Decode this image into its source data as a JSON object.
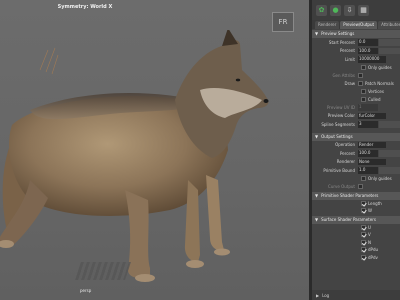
{
  "viewport": {
    "title": "Symmetry: World X",
    "bottom_label": "persp",
    "view_cube_label": "FR"
  },
  "toolbar": {
    "icons": [
      "fur-icon",
      "turtle-icon",
      "down-arrow-icon",
      "grid-icon"
    ]
  },
  "tabs": [
    {
      "label": "Renderer",
      "active": false
    },
    {
      "label": "Preview/Output",
      "active": true
    },
    {
      "label": "Attributes",
      "active": false
    }
  ],
  "preview_settings": {
    "header": "Preview Settings",
    "start_percent": {
      "label": "Start Percent",
      "value": "0.0"
    },
    "percent": {
      "label": "Percent",
      "value": "100.0"
    },
    "limit": {
      "label": "Limit",
      "value": "10000000"
    },
    "only_guides": {
      "label": "Only guides",
      "checked": false
    },
    "gen_attrs_label": "Gen Attribs",
    "draw": {
      "label": "Draw"
    },
    "patch_normals": {
      "label": "Patch Normals",
      "checked": false
    },
    "vertices": {
      "label": "Vertices",
      "checked": false
    },
    "culled": {
      "label": "Culled",
      "checked": false
    },
    "preview_uv_id": {
      "label": "Preview UV ID",
      "value": "1"
    },
    "preview_color": {
      "label": "Preview Color",
      "value": "furColor"
    },
    "spline_segments": {
      "label": "Spline Segments",
      "value": "3"
    }
  },
  "output_settings": {
    "header": "Output Settings",
    "operation": {
      "label": "Operation",
      "value": "Render"
    },
    "percent": {
      "label": "Percent",
      "value": "100.0"
    },
    "renderer": {
      "label": "Renderer",
      "value": "None"
    },
    "primitive_bound": {
      "label": "Primitive Bound",
      "value": "1.0"
    },
    "only_guides": {
      "label": "Only guides",
      "checked": false
    },
    "curve_output": {
      "label": "Curve Output"
    }
  },
  "primitive_shader": {
    "header": "Primitive Shader Parameters",
    "items": [
      {
        "label": "Length",
        "checked": true
      },
      {
        "label": "W",
        "checked": true
      }
    ]
  },
  "surface_shader": {
    "header": "Surface Shader Parameters",
    "items": [
      {
        "label": "U",
        "checked": true
      },
      {
        "label": "V",
        "checked": true
      },
      {
        "label": "N",
        "checked": true
      },
      {
        "label": "dPdu",
        "checked": true
      },
      {
        "label": "dPdv",
        "checked": true
      }
    ]
  },
  "bottom_bar": {
    "label": "Log"
  },
  "colors": {
    "viewport_bg": "#666666",
    "panel_bg": "#444444",
    "accent_green": "#4fb85a"
  }
}
